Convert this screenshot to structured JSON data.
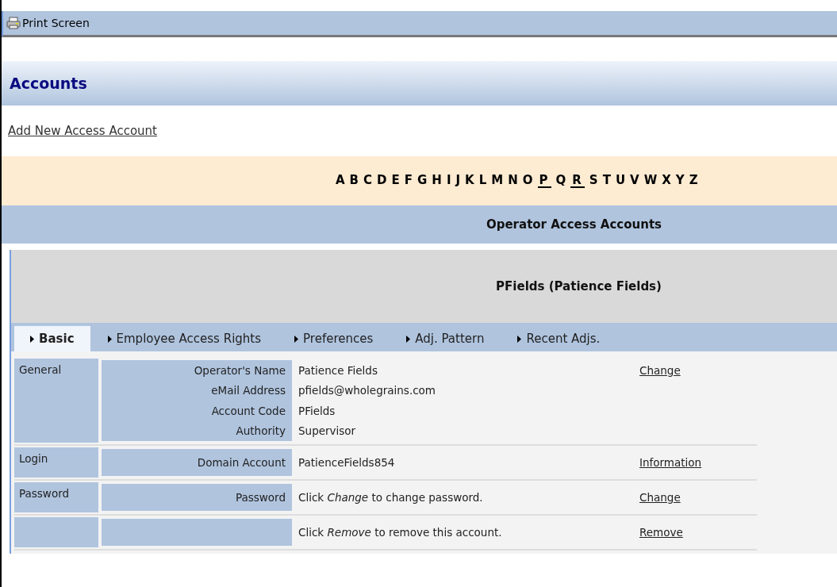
{
  "toolbar": {
    "print_label": "Print Screen"
  },
  "page_title": "Accounts",
  "add_link": "Add New Access Account",
  "alphabet": [
    {
      "letter": "A",
      "linked": false
    },
    {
      "letter": "B",
      "linked": false
    },
    {
      "letter": "C",
      "linked": false
    },
    {
      "letter": "D",
      "linked": false
    },
    {
      "letter": "E",
      "linked": false
    },
    {
      "letter": "F",
      "linked": false
    },
    {
      "letter": "G",
      "linked": false
    },
    {
      "letter": "H",
      "linked": false
    },
    {
      "letter": "I",
      "linked": false
    },
    {
      "letter": "J",
      "linked": false
    },
    {
      "letter": "K",
      "linked": false
    },
    {
      "letter": "L",
      "linked": false
    },
    {
      "letter": "M",
      "linked": false
    },
    {
      "letter": "N",
      "linked": false
    },
    {
      "letter": "O",
      "linked": false
    },
    {
      "letter": "P",
      "linked": true
    },
    {
      "letter": "Q",
      "linked": false
    },
    {
      "letter": "R",
      "linked": true
    },
    {
      "letter": "S",
      "linked": false
    },
    {
      "letter": "T",
      "linked": false
    },
    {
      "letter": "U",
      "linked": false
    },
    {
      "letter": "V",
      "linked": false
    },
    {
      "letter": "W",
      "linked": false
    },
    {
      "letter": "X",
      "linked": false
    },
    {
      "letter": "Y",
      "linked": false
    },
    {
      "letter": "Z",
      "linked": false
    }
  ],
  "section_title": "Operator Access Accounts",
  "account_title": "PFields (Patience Fields)",
  "tabs": [
    {
      "label": "Basic",
      "selected": true
    },
    {
      "label": "Employee Access Rights",
      "selected": false
    },
    {
      "label": "Preferences",
      "selected": false
    },
    {
      "label": "Adj. Pattern",
      "selected": false
    },
    {
      "label": "Recent Adjs.",
      "selected": false
    }
  ],
  "groups": [
    {
      "group": "General",
      "fields": [
        {
          "label": "Operator's Name",
          "value": "Patience Fields",
          "action": "Change"
        },
        {
          "label": "eMail Address",
          "value": "pfields@wholegrains.com"
        },
        {
          "label": "Account Code",
          "value": "PFields"
        },
        {
          "label": "Authority",
          "value": "Supervisor"
        }
      ]
    },
    {
      "group": "Login",
      "fields": [
        {
          "label": "Domain Account",
          "value": "PatienceFields854",
          "action": "Information"
        }
      ]
    },
    {
      "group": "Password",
      "fields": [
        {
          "label": "Password",
          "value": "Click *Change* to change password.",
          "action": "Change"
        }
      ]
    },
    {
      "fields": [
        {
          "value": "Click *Remove* to remove this account.",
          "action": "Remove"
        }
      ]
    }
  ]
}
